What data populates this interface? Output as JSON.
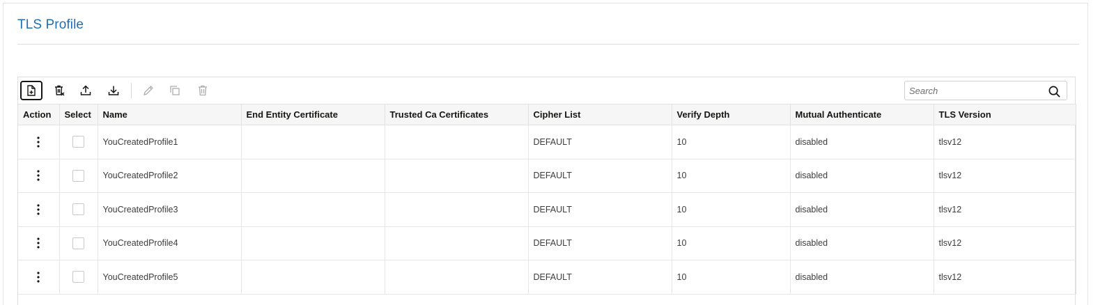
{
  "page": {
    "title": "TLS Profile"
  },
  "toolbar": {
    "buttons": [
      {
        "name": "create-icon",
        "label": "Create"
      },
      {
        "name": "delete-all-icon",
        "label": "Delete All"
      },
      {
        "name": "upload-icon",
        "label": "Import"
      },
      {
        "name": "download-icon",
        "label": "Export"
      },
      {
        "name": "edit-icon",
        "label": "Edit",
        "disabled": true
      },
      {
        "name": "clone-icon",
        "label": "Clone",
        "disabled": true
      },
      {
        "name": "delete-icon",
        "label": "Delete",
        "disabled": true
      }
    ],
    "search_placeholder": "Search"
  },
  "table": {
    "columns": [
      "Action",
      "Select",
      "Name",
      "End Entity Certificate",
      "Trusted Ca Certificates",
      "Cipher List",
      "Verify Depth",
      "Mutual Authenticate",
      "TLS Version"
    ],
    "rows": [
      {
        "name": "YouCreatedProfile1",
        "end_entity_certificate": "",
        "trusted_ca_certificates": "",
        "cipher_list": "DEFAULT",
        "verify_depth": "10",
        "mutual_authenticate": "disabled",
        "tls_version": "tlsv12"
      },
      {
        "name": "YouCreatedProfile2",
        "end_entity_certificate": "",
        "trusted_ca_certificates": "",
        "cipher_list": "DEFAULT",
        "verify_depth": "10",
        "mutual_authenticate": "disabled",
        "tls_version": "tlsv12"
      },
      {
        "name": "YouCreatedProfile3",
        "end_entity_certificate": "",
        "trusted_ca_certificates": "",
        "cipher_list": "DEFAULT",
        "verify_depth": "10",
        "mutual_authenticate": "disabled",
        "tls_version": "tlsv12"
      },
      {
        "name": "YouCreatedProfile4",
        "end_entity_certificate": "",
        "trusted_ca_certificates": "",
        "cipher_list": "DEFAULT",
        "verify_depth": "10",
        "mutual_authenticate": "disabled",
        "tls_version": "tlsv12"
      },
      {
        "name": "YouCreatedProfile5",
        "end_entity_certificate": "",
        "trusted_ca_certificates": "",
        "cipher_list": "DEFAULT",
        "verify_depth": "10",
        "mutual_authenticate": "disabled",
        "tls_version": "tlsv12"
      }
    ]
  },
  "colors": {
    "title": "#1f6fb5",
    "header_bg": "#f6f6f6",
    "text": "#161513"
  }
}
